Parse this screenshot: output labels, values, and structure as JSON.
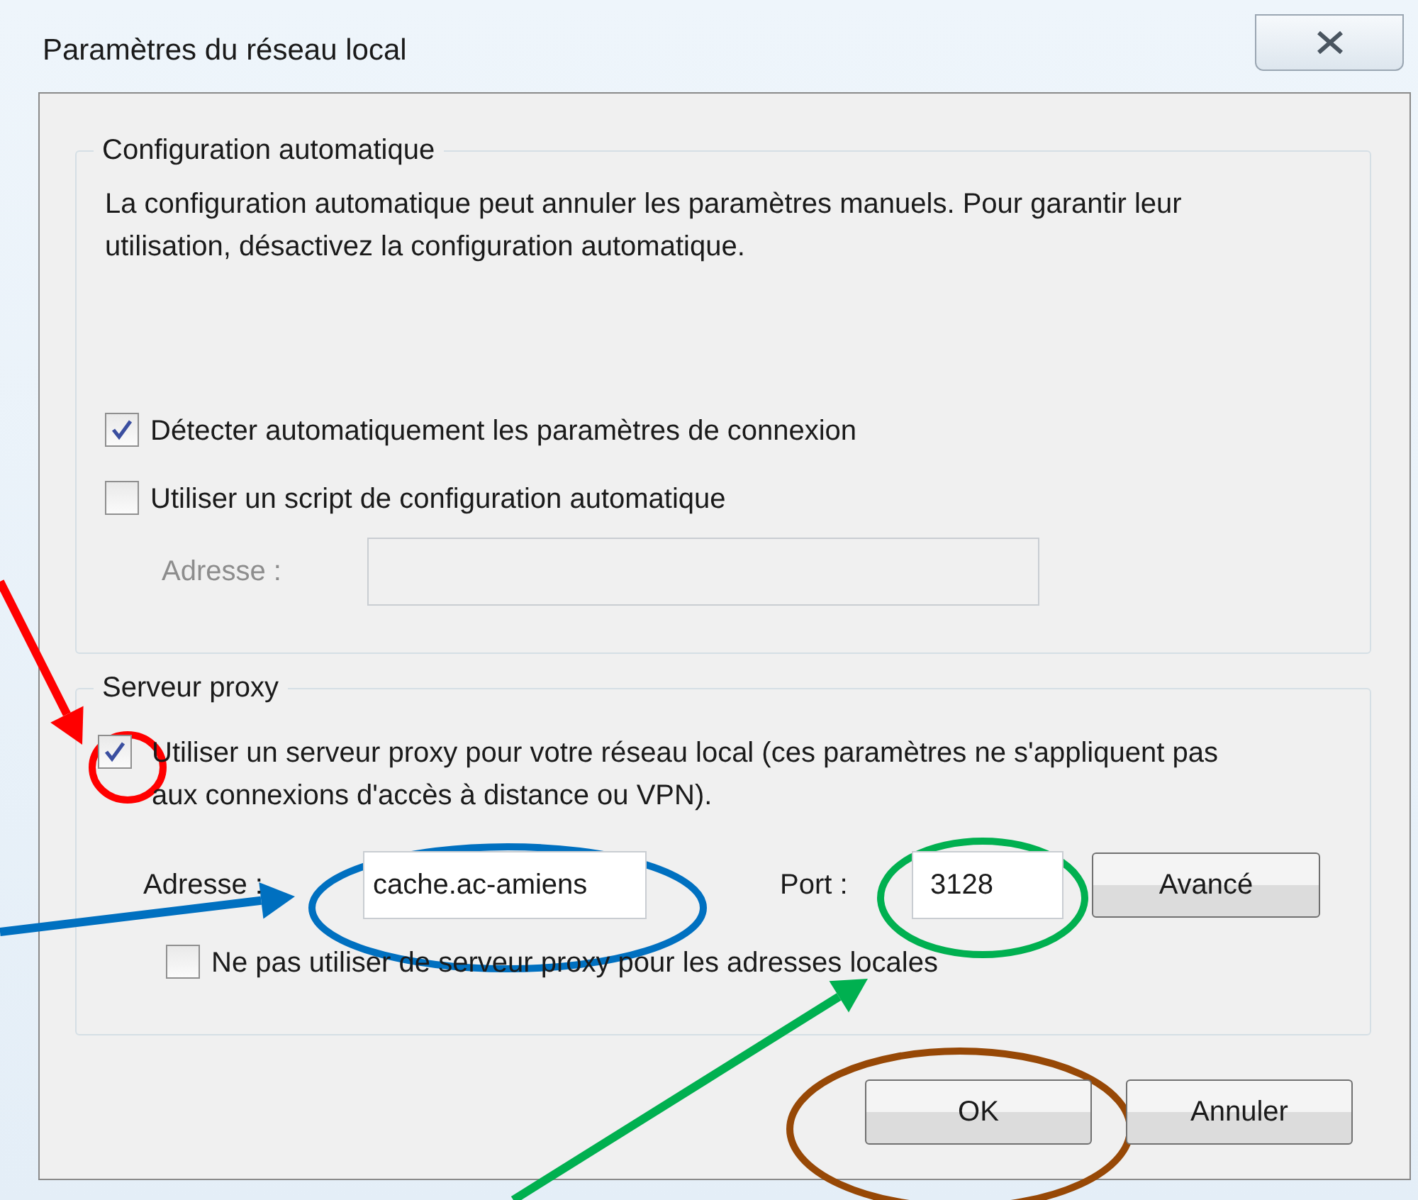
{
  "window": {
    "title": "Paramètres du réseau local"
  },
  "auto_config": {
    "title": "Configuration automatique",
    "description": "La configuration automatique peut annuler les paramètres manuels. Pour garantir leur utilisation, désactivez la configuration automatique.",
    "options": [
      {
        "label": "Détecter automatiquement les paramètres de connexion",
        "checked": true
      },
      {
        "label": "Utiliser un script de configuration automatique",
        "checked": false
      }
    ],
    "address": {
      "label": "Adresse :",
      "disabled": true
    }
  },
  "proxy": {
    "title": "Serveur proxy",
    "use_proxy": {
      "label": "Utiliser un serveur proxy pour votre réseau local (ces paramètres ne s'appliquent pas aux connexions d'accès à distance ou VPN).",
      "checked": true
    },
    "address": {
      "label": "Adresse :",
      "value": "cache.ac-amiens"
    },
    "port": {
      "label": "Port :",
      "value": "3128"
    },
    "advanced_button": "Avancé",
    "bypass_local": {
      "label": "Ne pas utiliser de serveur proxy pour les adresses locales",
      "checked": false
    }
  },
  "buttons": [
    "OK",
    "Annuler"
  ],
  "annotations": [
    {
      "kind": "arrow",
      "color": "#ff0000"
    },
    {
      "kind": "ellipse",
      "color": "#ff0000"
    },
    {
      "kind": "arrow",
      "color": "#0070c0"
    },
    {
      "kind": "ellipse",
      "color": "#0070c0"
    },
    {
      "kind": "arrow",
      "color": "#00b050"
    },
    {
      "kind": "ellipse",
      "color": "#00b050"
    },
    {
      "kind": "ellipse",
      "color": "#974806"
    }
  ]
}
